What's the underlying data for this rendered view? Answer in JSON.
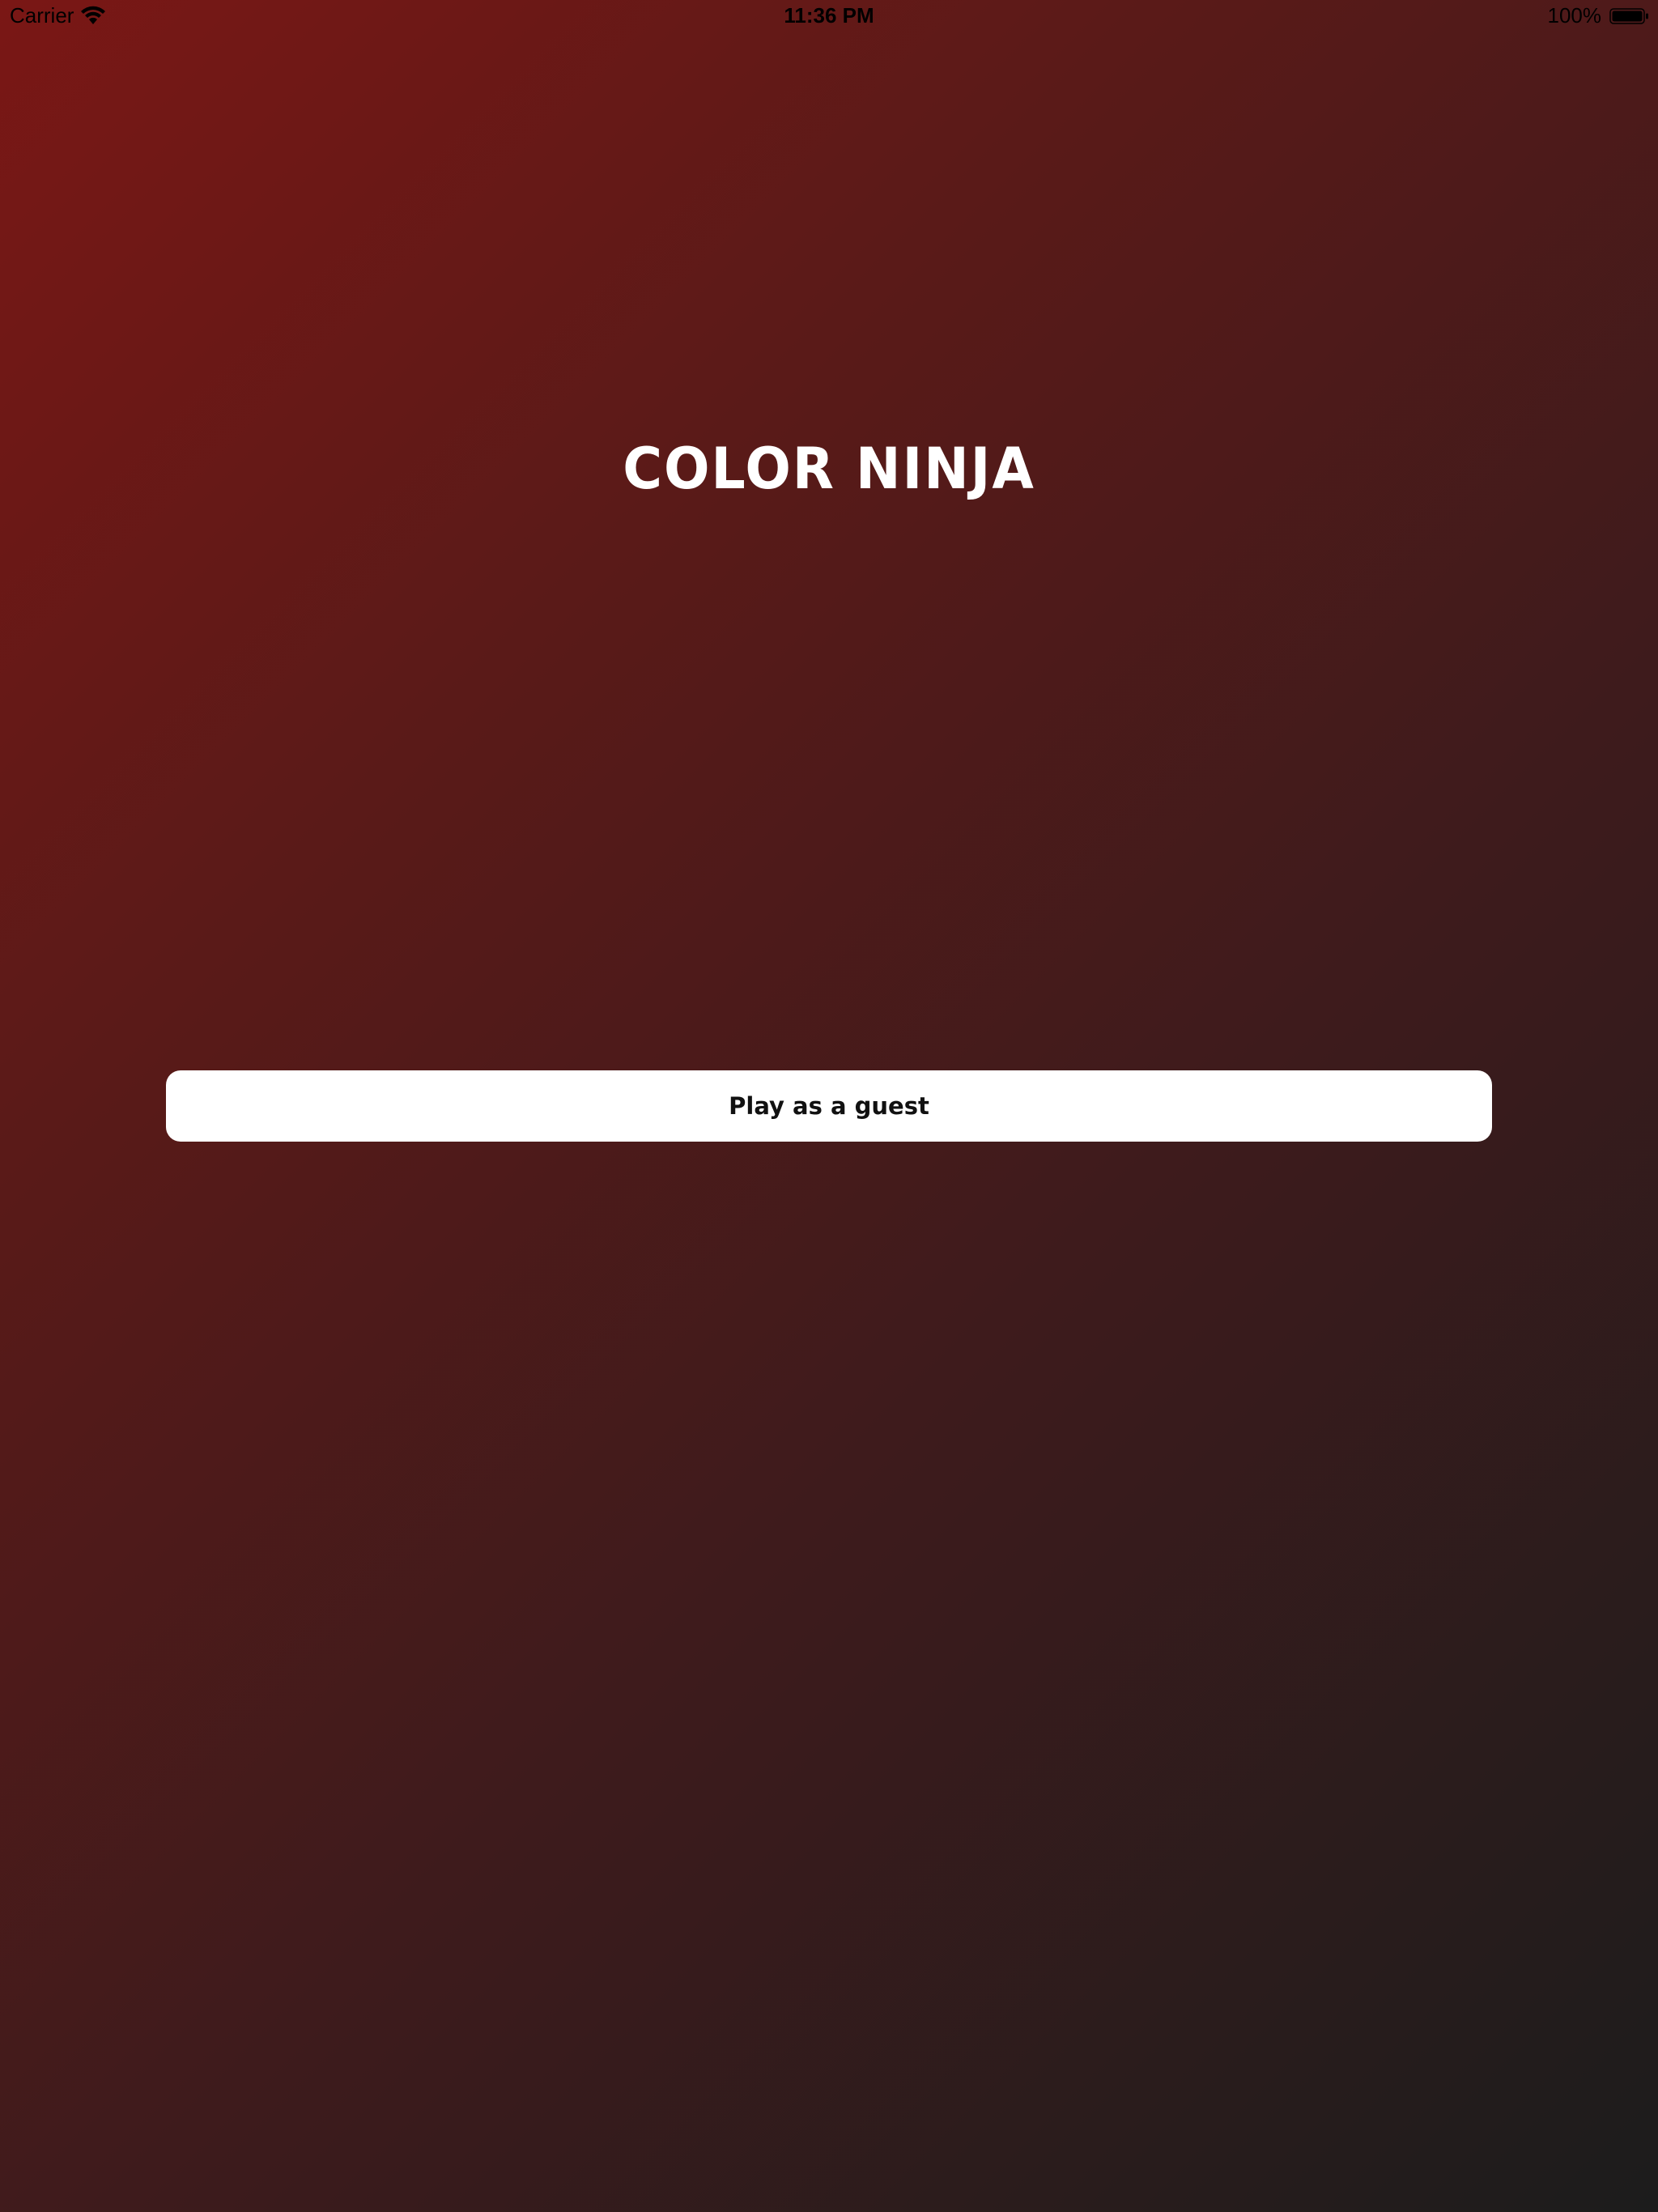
{
  "status_bar": {
    "carrier": "Carrier",
    "time": "11:36 PM",
    "battery": "100%",
    "wifi_icon": "wifi-icon",
    "battery_icon": "battery-icon"
  },
  "app": {
    "title": "COLOR NINJA"
  },
  "actions": {
    "guest_label": "Play as a guest"
  },
  "colors": {
    "gradient_start": "#7a1715",
    "gradient_end": "#1c1c1c",
    "button_bg": "#ffffff",
    "title_color": "#ffffff"
  }
}
